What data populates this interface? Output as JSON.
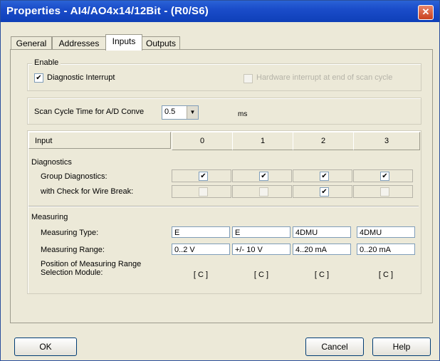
{
  "window": {
    "title": "Properties - AI4/AO4x14/12Bit - (R0/S6)",
    "close_glyph": "✕"
  },
  "tabs": [
    {
      "label": "General"
    },
    {
      "label": "Addresses"
    },
    {
      "label": "Inputs"
    },
    {
      "label": "Outputs"
    }
  ],
  "active_tab": "Inputs",
  "enable": {
    "group_label": "Enable",
    "diag_interrupt": {
      "label": "Diagnostic Interrupt",
      "checked": true
    },
    "hw_interrupt": {
      "label": "Hardware interrupt at end of scan cycle",
      "checked": false,
      "disabled": true
    }
  },
  "scan": {
    "label": "Scan Cycle Time for A/D Conve",
    "value": "0.5",
    "unit": "ms"
  },
  "table": {
    "header_label": "Input",
    "channels": [
      "0",
      "1",
      "2",
      "3"
    ],
    "diagnostics_label": "Diagnostics",
    "group_diag_label": "Group Diagnostics:",
    "wire_break_label": "with Check for Wire Break:",
    "group_diag": [
      true,
      true,
      true,
      true
    ],
    "wire_break": [
      false,
      false,
      true,
      false
    ],
    "measuring_label": "Measuring",
    "measuring_type_label": "Measuring Type:",
    "measuring_types": [
      "E",
      "E",
      "4DMU",
      "4DMU"
    ],
    "measuring_range_label": "Measuring Range:",
    "measuring_ranges": [
      "0..2 V",
      "+/- 10 V",
      "4..20 mA",
      "0..20 mA"
    ],
    "position_label_1": "Position of Measuring Range",
    "position_label_2": "Selection Module:",
    "positions": [
      "[ C ]",
      "[ C ]",
      "[ C ]",
      "[ C ]"
    ]
  },
  "buttons": {
    "ok": "OK",
    "cancel": "Cancel",
    "help": "Help"
  },
  "colors": {
    "titlebar": "#1a4cc9",
    "dialog_bg": "#ece9d8",
    "field_border": "#7f9db9"
  }
}
